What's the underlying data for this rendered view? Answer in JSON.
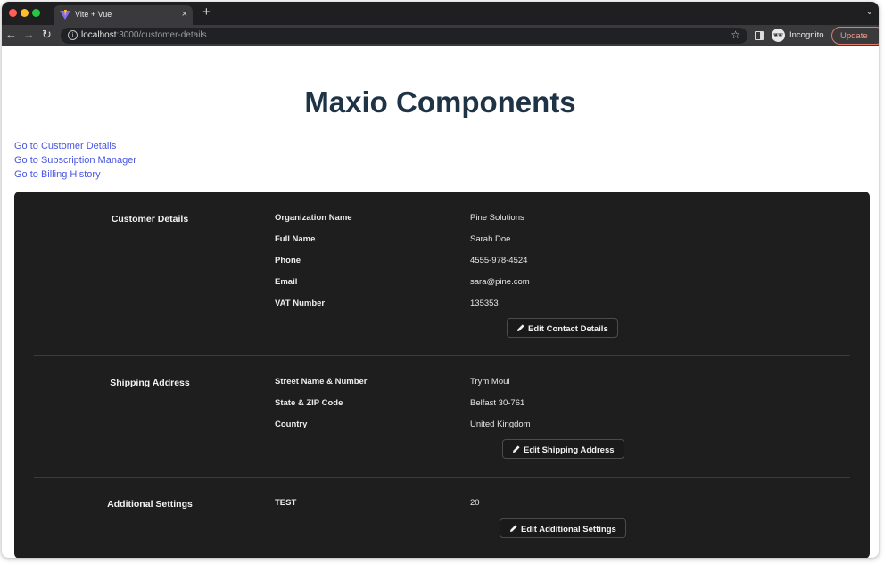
{
  "browser": {
    "tab_title": "Vite + Vue",
    "tab_close": "×",
    "new_tab": "+",
    "tab_dropdown": "⌄",
    "url_host": "localhost",
    "url_path": ":3000/customer-details",
    "incognito_label": "Incognito",
    "update_label": "Update",
    "nav_back": "←",
    "nav_forward": "→",
    "nav_reload": "↻",
    "star": "☆",
    "info": "i"
  },
  "page": {
    "title": "Maxio Components",
    "links": [
      {
        "label": "Go to Customer Details"
      },
      {
        "label": "Go to Subscription Manager"
      },
      {
        "label": "Go to Billing History"
      }
    ]
  },
  "sections": {
    "customer": {
      "title": "Customer Details",
      "fields": [
        {
          "label": "Organization Name",
          "value": "Pine Solutions"
        },
        {
          "label": "Full Name",
          "value": "Sarah Doe"
        },
        {
          "label": "Phone",
          "value": "4555-978-4524"
        },
        {
          "label": "Email",
          "value": "sara@pine.com"
        },
        {
          "label": "VAT Number",
          "value": "135353"
        }
      ],
      "button_label": "Edit Contact Details"
    },
    "shipping": {
      "title": "Shipping Address",
      "fields": [
        {
          "label": "Street Name & Number",
          "value": "Trym Moui"
        },
        {
          "label": "State & ZIP Code",
          "value": "Belfast 30-761"
        },
        {
          "label": "Country",
          "value": "United Kingdom"
        }
      ],
      "button_label": "Edit Shipping Address"
    },
    "additional": {
      "title": "Additional Settings",
      "fields": [
        {
          "label": "TEST",
          "value": "20"
        }
      ],
      "button_label": "Edit Additional Settings"
    }
  }
}
